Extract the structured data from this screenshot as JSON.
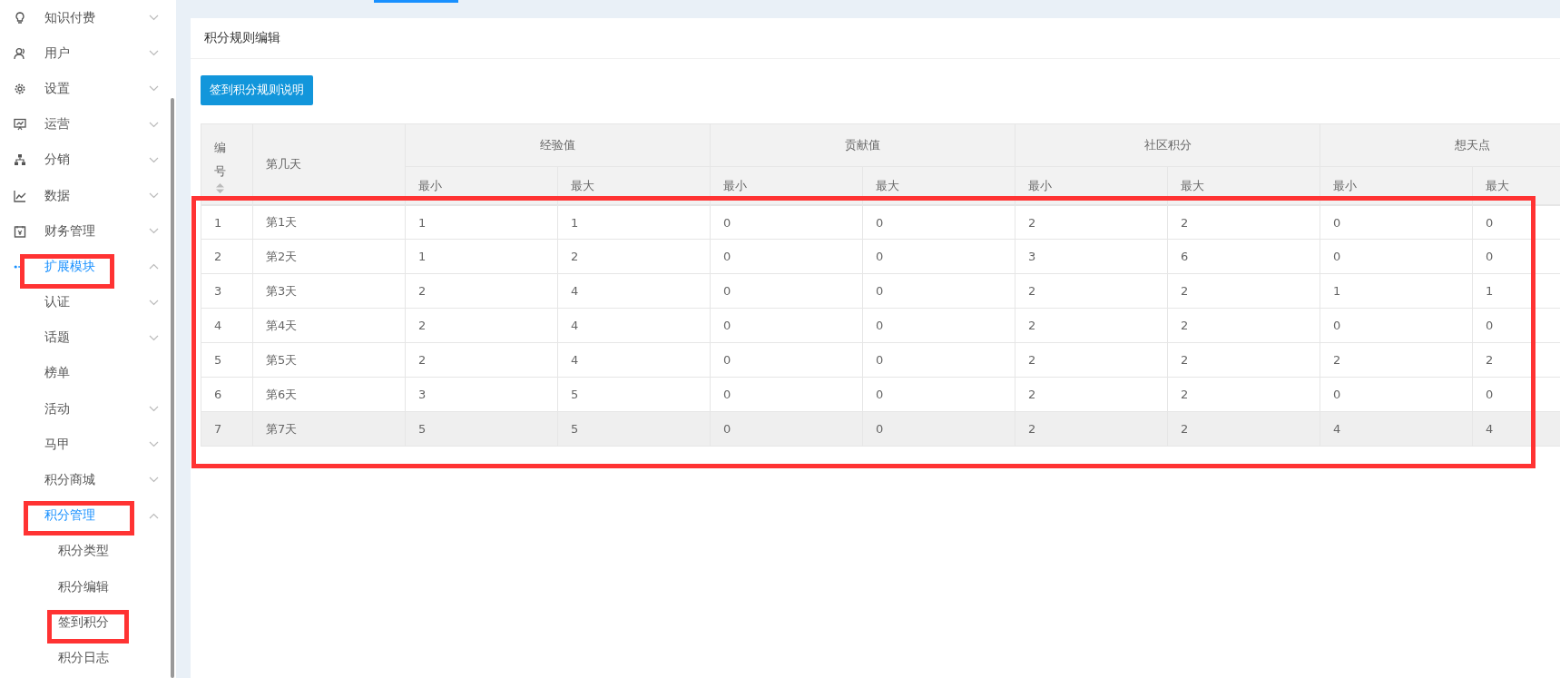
{
  "sidebar": {
    "items": [
      {
        "label": "知识付费",
        "expanded": false,
        "active": false
      },
      {
        "label": "用户",
        "expanded": false,
        "active": false
      },
      {
        "label": "设置",
        "expanded": false,
        "active": false
      },
      {
        "label": "运营",
        "expanded": false,
        "active": false
      },
      {
        "label": "分销",
        "expanded": false,
        "active": false
      },
      {
        "label": "数据",
        "expanded": false,
        "active": false
      },
      {
        "label": "财务管理",
        "expanded": false,
        "active": false
      },
      {
        "label": "扩展模块",
        "expanded": true,
        "active": true,
        "highlighted": true,
        "children": [
          {
            "label": "认证",
            "expanded": false,
            "active": false
          },
          {
            "label": "话题",
            "expanded": false,
            "active": false
          },
          {
            "label": "榜单",
            "active": false
          },
          {
            "label": "活动",
            "expanded": false,
            "active": false
          },
          {
            "label": "马甲",
            "expanded": false,
            "active": false
          },
          {
            "label": "积分商城",
            "expanded": false,
            "active": false
          },
          {
            "label": "积分管理",
            "expanded": true,
            "active": true,
            "highlighted": true,
            "children": [
              {
                "label": "积分类型",
                "active": false
              },
              {
                "label": "积分编辑",
                "active": false
              },
              {
                "label": "签到积分",
                "active": false,
                "highlighted": true
              },
              {
                "label": "积分日志",
                "active": false
              }
            ]
          }
        ]
      }
    ]
  },
  "card": {
    "title": "积分规则编辑",
    "button": "签到积分规则说明"
  },
  "table": {
    "highlighted": true,
    "columns": [
      {
        "label": "编号",
        "sortable": true
      },
      {
        "label": "第几天",
        "sortable": false
      }
    ],
    "groups": [
      {
        "label": "经验值",
        "subcolumns": [
          "最小",
          "最大"
        ]
      },
      {
        "label": "贡献值",
        "subcolumns": [
          "最小",
          "最大"
        ]
      },
      {
        "label": "社区积分",
        "subcolumns": [
          "最小",
          "最大"
        ]
      },
      {
        "label": "想天点",
        "subcolumns": [
          "最小",
          "最大"
        ]
      }
    ],
    "rows": [
      {
        "hovered": false,
        "cells": [
          "1",
          "第1天",
          "1",
          "1",
          "0",
          "0",
          "2",
          "2",
          "0",
          "0"
        ]
      },
      {
        "hovered": false,
        "cells": [
          "2",
          "第2天",
          "1",
          "2",
          "0",
          "0",
          "3",
          "6",
          "0",
          "0"
        ]
      },
      {
        "hovered": false,
        "cells": [
          "3",
          "第3天",
          "2",
          "4",
          "0",
          "0",
          "2",
          "2",
          "1",
          "1"
        ]
      },
      {
        "hovered": false,
        "cells": [
          "4",
          "第4天",
          "2",
          "4",
          "0",
          "0",
          "2",
          "2",
          "0",
          "0"
        ]
      },
      {
        "hovered": false,
        "cells": [
          "5",
          "第5天",
          "2",
          "4",
          "0",
          "0",
          "2",
          "2",
          "2",
          "2"
        ]
      },
      {
        "hovered": false,
        "cells": [
          "6",
          "第6天",
          "3",
          "5",
          "0",
          "0",
          "2",
          "2",
          "0",
          "0"
        ]
      },
      {
        "hovered": true,
        "cells": [
          "7",
          "第7天",
          "5",
          "5",
          "0",
          "0",
          "2",
          "2",
          "4",
          "4"
        ]
      }
    ]
  }
}
